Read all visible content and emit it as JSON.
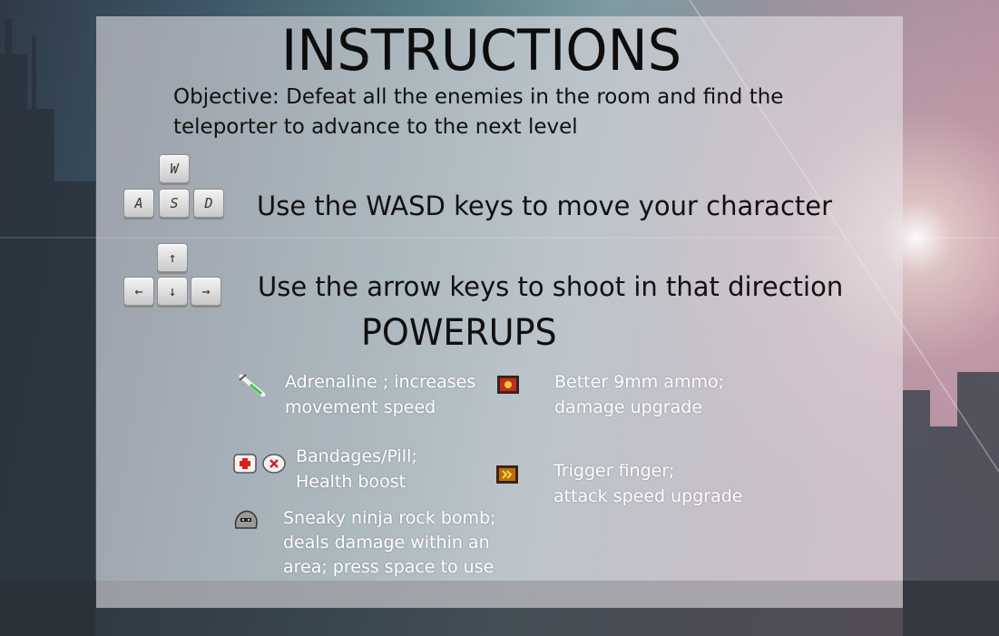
{
  "title": "INSTRUCTIONS",
  "objective": "Objective: Defeat all the enemies in the room and find the teleporter to advance to the next level",
  "controls": {
    "wasd_keys": [
      "W",
      "A",
      "S",
      "D"
    ],
    "wasd_text": "Use the WASD keys to move your character",
    "arrow_keys": [
      "↑",
      "←",
      "↓",
      "→"
    ],
    "arrow_text": "Use the arrow keys to shoot in that direction"
  },
  "powerups_heading": "POWERUPS",
  "powerups": [
    {
      "icon": "syringe-icon",
      "line1": "Adrenaline ; increases",
      "line2": "movement speed"
    },
    {
      "icon": "ammo-crate-icon",
      "line1": "Better 9mm ammo;",
      "line2": "damage upgrade"
    },
    {
      "icon": "bandage-pill-icon",
      "line1": "Bandages/Pill;",
      "line2": "Health boost"
    },
    {
      "icon": "trigger-crate-icon",
      "line1": "Trigger finger;",
      "line2": "attack speed upgrade"
    },
    {
      "icon": "rock-bomb-icon",
      "line1": "Sneaky ninja rock bomb;",
      "line2": "deals damage within an",
      "line3": "area; press space to use"
    }
  ],
  "colors": {
    "panel": "#e9e4e9",
    "heading_text": "#111111",
    "powerup_text": "#ffffff"
  }
}
